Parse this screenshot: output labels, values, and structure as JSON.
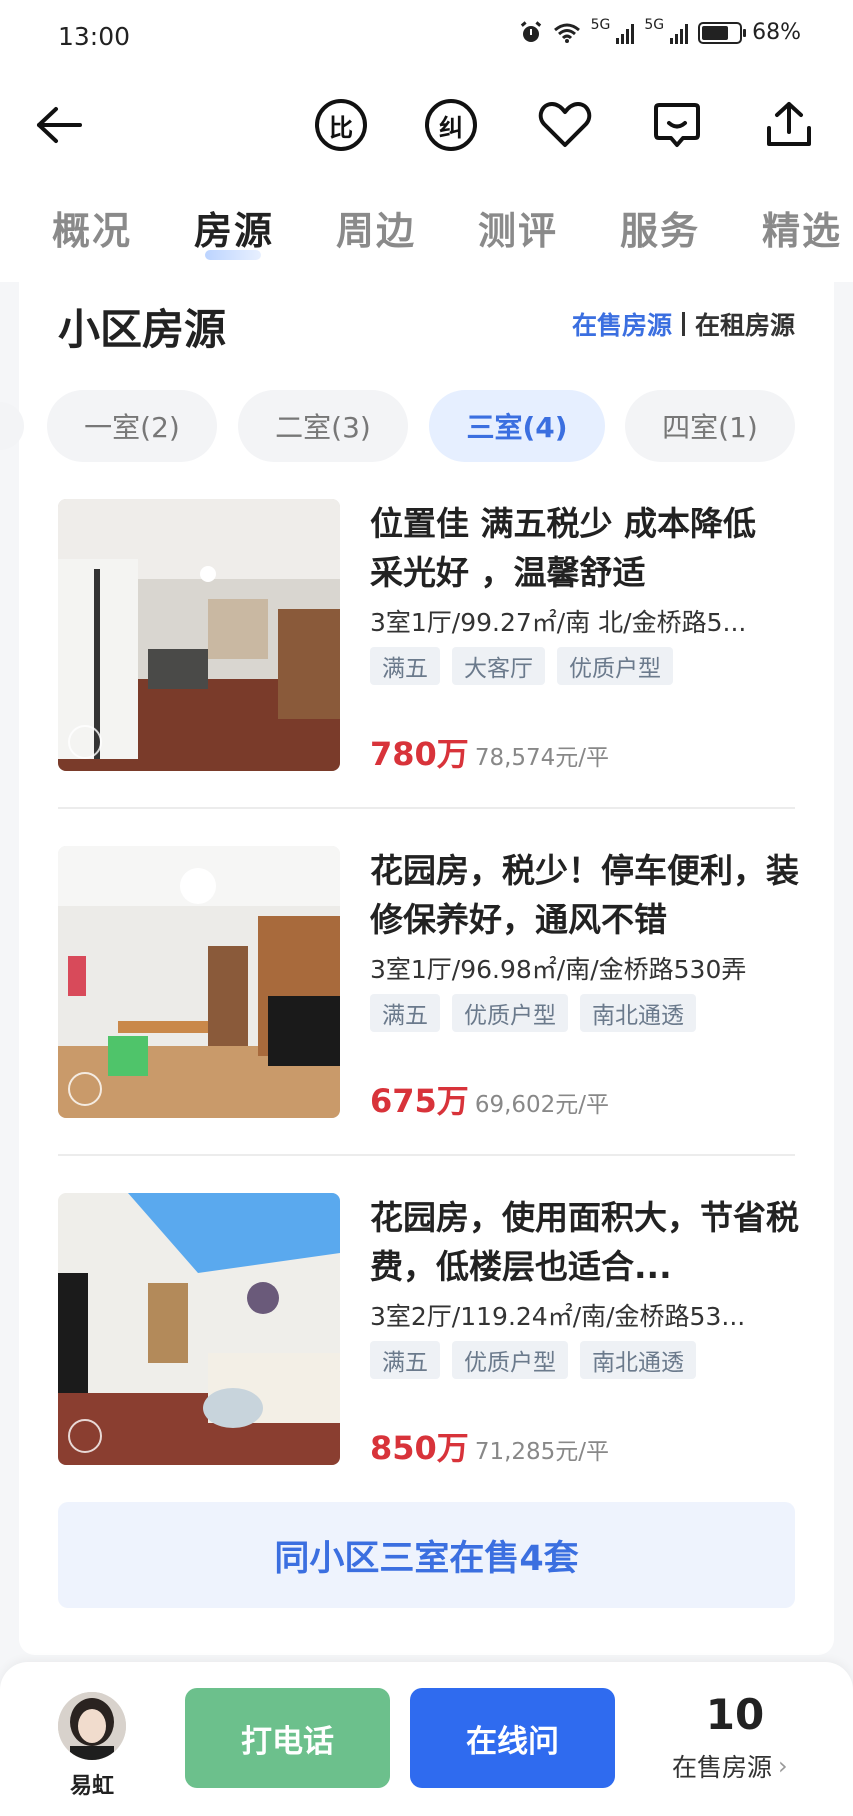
{
  "status_bar": {
    "time": "13:00",
    "signal_1": "5G",
    "signal_2": "5G",
    "battery": "68%",
    "icons": [
      "alarm-icon",
      "wifi-icon",
      "signal-icon",
      "battery-icon"
    ]
  },
  "nav": {
    "icons": [
      "back-arrow-icon",
      "compare-icon",
      "correction-icon",
      "heart-icon",
      "message-icon",
      "share-icon"
    ],
    "compare_char": "比",
    "correct_char": "纠"
  },
  "tabs": [
    {
      "label": "概况",
      "active": false
    },
    {
      "label": "房源",
      "active": true
    },
    {
      "label": "周边",
      "active": false
    },
    {
      "label": "测评",
      "active": false
    },
    {
      "label": "服务",
      "active": false
    },
    {
      "label": "精选",
      "active": false
    }
  ],
  "section": {
    "title": "小区房源",
    "link_sale": "在售房源",
    "link_rent": "在租房源"
  },
  "filters": [
    {
      "label": "一室(2)",
      "active": false
    },
    {
      "label": "二室(3)",
      "active": false
    },
    {
      "label": "三室(4)",
      "active": true
    },
    {
      "label": "四室(1)",
      "active": false
    }
  ],
  "listings": [
    {
      "title": "位置佳 满五税少 成本降低 采光好 ，温馨舒适",
      "meta": "3室1厅/99.27㎡/南 北/金桥路5...",
      "tags": [
        "满五",
        "大客厅",
        "优质户型"
      ],
      "price": "780万",
      "unit_price": "78,574元/平"
    },
    {
      "title": "花园房，税少！停车便利，装修保养好，通风不错",
      "meta": "3室1厅/96.98㎡/南/金桥路530弄",
      "tags": [
        "满五",
        "优质户型",
        "南北通透"
      ],
      "price": "675万",
      "unit_price": "69,602元/平"
    },
    {
      "title": "花园房，使用面积大，节省税费，低楼层也适合...",
      "meta": "3室2厅/119.24㎡/南/金桥路53...",
      "tags": [
        "满五",
        "优质户型",
        "南北通透"
      ],
      "price": "850万",
      "unit_price": "71,285元/平"
    }
  ],
  "more_button": "同小区三室在售4套",
  "bottom_bar": {
    "agent_name": "易虹",
    "call_label": "打电话",
    "chat_label": "在线问",
    "sale_count": "10",
    "sale_label": "在售房源"
  },
  "colors": {
    "accent": "#2f6bef",
    "link": "#3b6fe0",
    "price": "#d8333a",
    "call": "#6cc08c"
  }
}
